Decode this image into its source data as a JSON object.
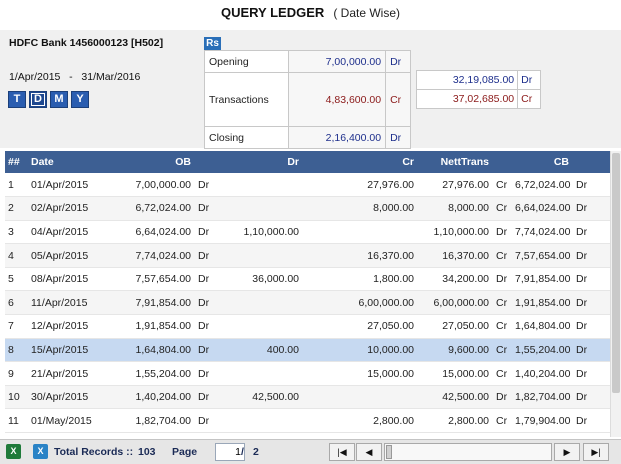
{
  "header": {
    "title": "QUERY LEDGER",
    "subtitle": "( Date Wise)"
  },
  "account": {
    "name": "HDFC Bank 1456000123 [H502]",
    "from": "1/Apr/2015",
    "sep": "-",
    "to": "31/Mar/2016"
  },
  "period_buttons": [
    "T",
    "D",
    "M",
    "Y"
  ],
  "currency": "Rs",
  "summary": {
    "opening": {
      "label": "Opening",
      "value": "7,00,000.00",
      "drcr": "Dr"
    },
    "transactions": {
      "label": "Transactions",
      "value": "4,83,600.00",
      "drcr": "Cr"
    },
    "closing": {
      "label": "Closing",
      "value": "2,16,400.00",
      "drcr": "Dr"
    },
    "side": [
      {
        "value": "32,19,085.00",
        "drcr": "Dr"
      },
      {
        "value": "37,02,685.00",
        "drcr": "Cr"
      }
    ]
  },
  "ledger": {
    "columns": {
      "num": "##",
      "date": "Date",
      "ob": "OB",
      "dr": "Dr",
      "cr": "Cr",
      "nett": "NettTrans",
      "cb": "CB"
    },
    "rows": [
      {
        "n": "1",
        "date": "01/Apr/2015",
        "ob": "7,00,000.00",
        "ob_t": "Dr",
        "dr": "",
        "cr": "27,976.00",
        "nett": "27,976.00",
        "nett_t": "Cr",
        "cb": "6,72,024.00",
        "cb_t": "Dr"
      },
      {
        "n": "2",
        "date": "02/Apr/2015",
        "ob": "6,72,024.00",
        "ob_t": "Dr",
        "dr": "",
        "cr": "8,000.00",
        "nett": "8,000.00",
        "nett_t": "Cr",
        "cb": "6,64,024.00",
        "cb_t": "Dr"
      },
      {
        "n": "3",
        "date": "04/Apr/2015",
        "ob": "6,64,024.00",
        "ob_t": "Dr",
        "dr": "1,10,000.00",
        "cr": "",
        "nett": "1,10,000.00",
        "nett_t": "Dr",
        "cb": "7,74,024.00",
        "cb_t": "Dr"
      },
      {
        "n": "4",
        "date": "05/Apr/2015",
        "ob": "7,74,024.00",
        "ob_t": "Dr",
        "dr": "",
        "cr": "16,370.00",
        "nett": "16,370.00",
        "nett_t": "Cr",
        "cb": "7,57,654.00",
        "cb_t": "Dr"
      },
      {
        "n": "5",
        "date": "08/Apr/2015",
        "ob": "7,57,654.00",
        "ob_t": "Dr",
        "dr": "36,000.00",
        "cr": "1,800.00",
        "nett": "34,200.00",
        "nett_t": "Dr",
        "cb": "7,91,854.00",
        "cb_t": "Dr"
      },
      {
        "n": "6",
        "date": "11/Apr/2015",
        "ob": "7,91,854.00",
        "ob_t": "Dr",
        "dr": "",
        "cr": "6,00,000.00",
        "nett": "6,00,000.00",
        "nett_t": "Cr",
        "cb": "1,91,854.00",
        "cb_t": "Dr"
      },
      {
        "n": "7",
        "date": "12/Apr/2015",
        "ob": "1,91,854.00",
        "ob_t": "Dr",
        "dr": "",
        "cr": "27,050.00",
        "nett": "27,050.00",
        "nett_t": "Cr",
        "cb": "1,64,804.00",
        "cb_t": "Dr"
      },
      {
        "n": "8",
        "date": "15/Apr/2015",
        "ob": "1,64,804.00",
        "ob_t": "Dr",
        "dr": "400.00",
        "cr": "10,000.00",
        "nett": "9,600.00",
        "nett_t": "Cr",
        "cb": "1,55,204.00",
        "cb_t": "Dr"
      },
      {
        "n": "9",
        "date": "21/Apr/2015",
        "ob": "1,55,204.00",
        "ob_t": "Dr",
        "dr": "",
        "cr": "15,000.00",
        "nett": "15,000.00",
        "nett_t": "Cr",
        "cb": "1,40,204.00",
        "cb_t": "Dr"
      },
      {
        "n": "10",
        "date": "30/Apr/2015",
        "ob": "1,40,204.00",
        "ob_t": "Dr",
        "dr": "42,500.00",
        "cr": "",
        "nett": "42,500.00",
        "nett_t": "Dr",
        "cb": "1,82,704.00",
        "cb_t": "Dr"
      },
      {
        "n": "11",
        "date": "01/May/2015",
        "ob": "1,82,704.00",
        "ob_t": "Dr",
        "dr": "",
        "cr": "2,800.00",
        "nett": "2,800.00",
        "nett_t": "Cr",
        "cb": "1,79,904.00",
        "cb_t": "Dr"
      }
    ],
    "selected_row": 7
  },
  "footer": {
    "total_label": "Total Records ::",
    "total_value": "103",
    "page_label": "Page",
    "page_value": "1",
    "page_sep": "/",
    "page_total": "2",
    "icons": [
      "excel-icon",
      "csv-icon"
    ],
    "nav": {
      "first": "|◀",
      "prev": "◀",
      "next": "▶",
      "last": "▶|"
    }
  },
  "colors": {
    "header_blue": "#3d5f93",
    "selected_row": "#c6d9f1",
    "dr_blue": "#1e2f8c",
    "cr_red": "#8b1a1a"
  }
}
